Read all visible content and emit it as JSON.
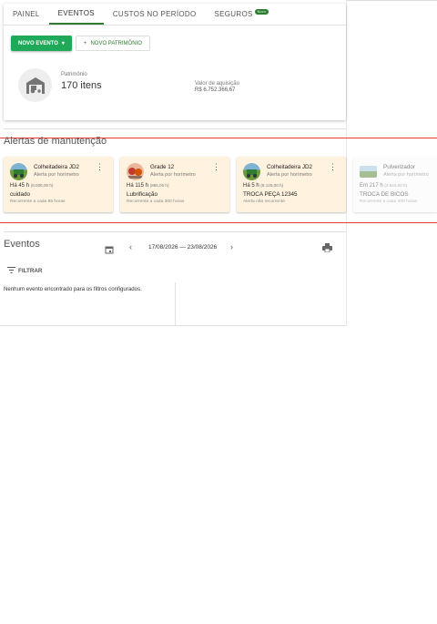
{
  "tabs": [
    {
      "label": "PAINEL"
    },
    {
      "label": "EVENTOS"
    },
    {
      "label": "CUSTOS NO PERÍODO"
    },
    {
      "label": "SEGUROS",
      "badge": "Novo"
    }
  ],
  "actions": {
    "new_event_label": "NOVO EVENTO",
    "new_asset_label": "NOVO PATRIMÔNIO"
  },
  "summary": {
    "patrimonio_label": "Patrimônio",
    "patrimonio_value": "170 itens",
    "acquisition_label": "Valor de aquisição",
    "acquisition_value": "R$ 6.752.366,67"
  },
  "alerts": {
    "title": "Alertas de manutenção",
    "items": [
      {
        "title": "Colheitadeira JD2",
        "subtitle": "Alerta por horímetro",
        "time": "Há 45 h",
        "time_detail": "(8.005,00 h)",
        "name": "cuidado",
        "recurrence": "Recorrente a cada 85 horas"
      },
      {
        "title": "Grade 12",
        "subtitle": "Alerta por horímetro",
        "time": "Há 115 h",
        "time_detail": "(885,00 h)",
        "name": "Lubrificação",
        "recurrence": "Recorrente a cada 300 horas"
      },
      {
        "title": "Colheitadeira JD2",
        "subtitle": "Alerta por horímetro",
        "time": "Há 5 h",
        "time_detail": "(8.125,00 h)",
        "name": "TROCA PEÇA 12345",
        "recurrence": "Alerta não recorrente"
      },
      {
        "title": "Pulverizador",
        "subtitle": "Alerta por horímetro",
        "time": "Em 217 h",
        "time_detail": "(3.543,00 h)",
        "name": "TROCA DE BICOS",
        "recurrence": "Recorrente a cada 300 horas"
      }
    ]
  },
  "events": {
    "title": "Eventos",
    "date_range": "17/08/2026 — 23/08/2026",
    "filter_label": "FILTRAR",
    "empty_message": "Nenhum evento encontrado para os filtros configurados."
  },
  "colors": {
    "accent": "#1faa59",
    "alert_bg": "#fff3e0",
    "alert_border": "#e53935"
  }
}
